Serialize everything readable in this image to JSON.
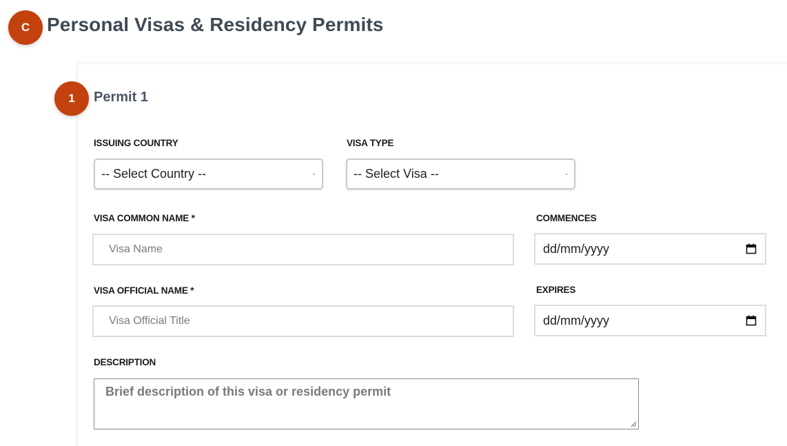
{
  "section": {
    "badge": "C",
    "title": "Personal Visas & Residency Permits"
  },
  "permit": {
    "badge": "1",
    "title": "Permit 1"
  },
  "form": {
    "issuing_country": {
      "label": "ISSUING COUNTRY",
      "selected": "-- Select Country --"
    },
    "visa_type": {
      "label": "VISA TYPE",
      "selected": "-- Select Visa --"
    },
    "visa_common_name": {
      "label": "VISA COMMON NAME *",
      "placeholder": "Visa Name"
    },
    "commences": {
      "label": "COMMENCES",
      "value": "dd/mm/yyyy"
    },
    "visa_official_name": {
      "label": "VISA OFFICIAL NAME *",
      "placeholder": "Visa Official Title"
    },
    "expires": {
      "label": "EXPIRES",
      "value": "dd/mm/yyyy"
    },
    "description": {
      "label": "DESCRIPTION",
      "placeholder": "Brief description of this visa or residency permit"
    }
  },
  "colors": {
    "badge": "#c2410c",
    "heading": "#3f4a55"
  },
  "icons": {
    "calendar": "calendar-icon",
    "select_arrow": "chevron-down-icon"
  }
}
